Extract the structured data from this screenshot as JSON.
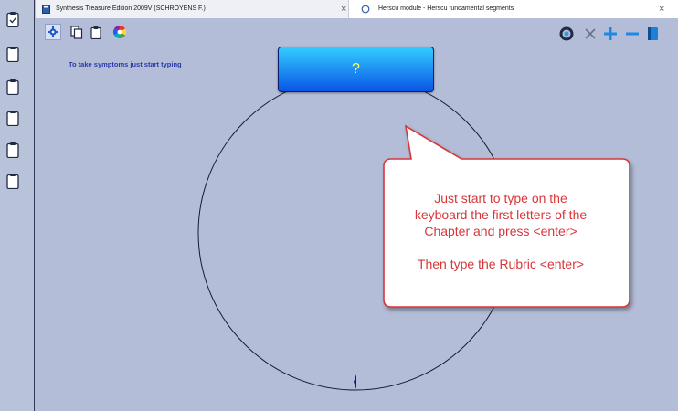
{
  "tabs": [
    {
      "label": "Synthesis Treasure Edition 2009V (SCHROYENS F.)",
      "close": "×"
    },
    {
      "label": "Herscu module - Herscu fundamental segments",
      "close": "×"
    }
  ],
  "toolbar": {
    "left_icons": [
      "settings-icon",
      "copy-icon",
      "clipboard-icon",
      "color-wheel-icon"
    ],
    "right_icons": [
      "circle-target-icon",
      "close-icon",
      "plus-icon",
      "minus-icon",
      "book-icon"
    ]
  },
  "sidebar": {
    "icons": [
      "clipboard-check-icon",
      "clipboard-icon",
      "clipboard-icon",
      "clipboard-icon",
      "clipboard-icon",
      "clipboard-icon"
    ]
  },
  "hint": "To take symptoms just start typing",
  "question_box": {
    "label": "?"
  },
  "callout": {
    "line1": "Just start to type on the",
    "line2": "keyboard the first letters of the",
    "line3": "Chapter and press <enter>",
    "line4": "Then type the Rubric <enter>"
  },
  "colors": {
    "accent": "#1aa3e8",
    "callout_text": "#d8373a",
    "hint_text": "#2a3aa8"
  }
}
